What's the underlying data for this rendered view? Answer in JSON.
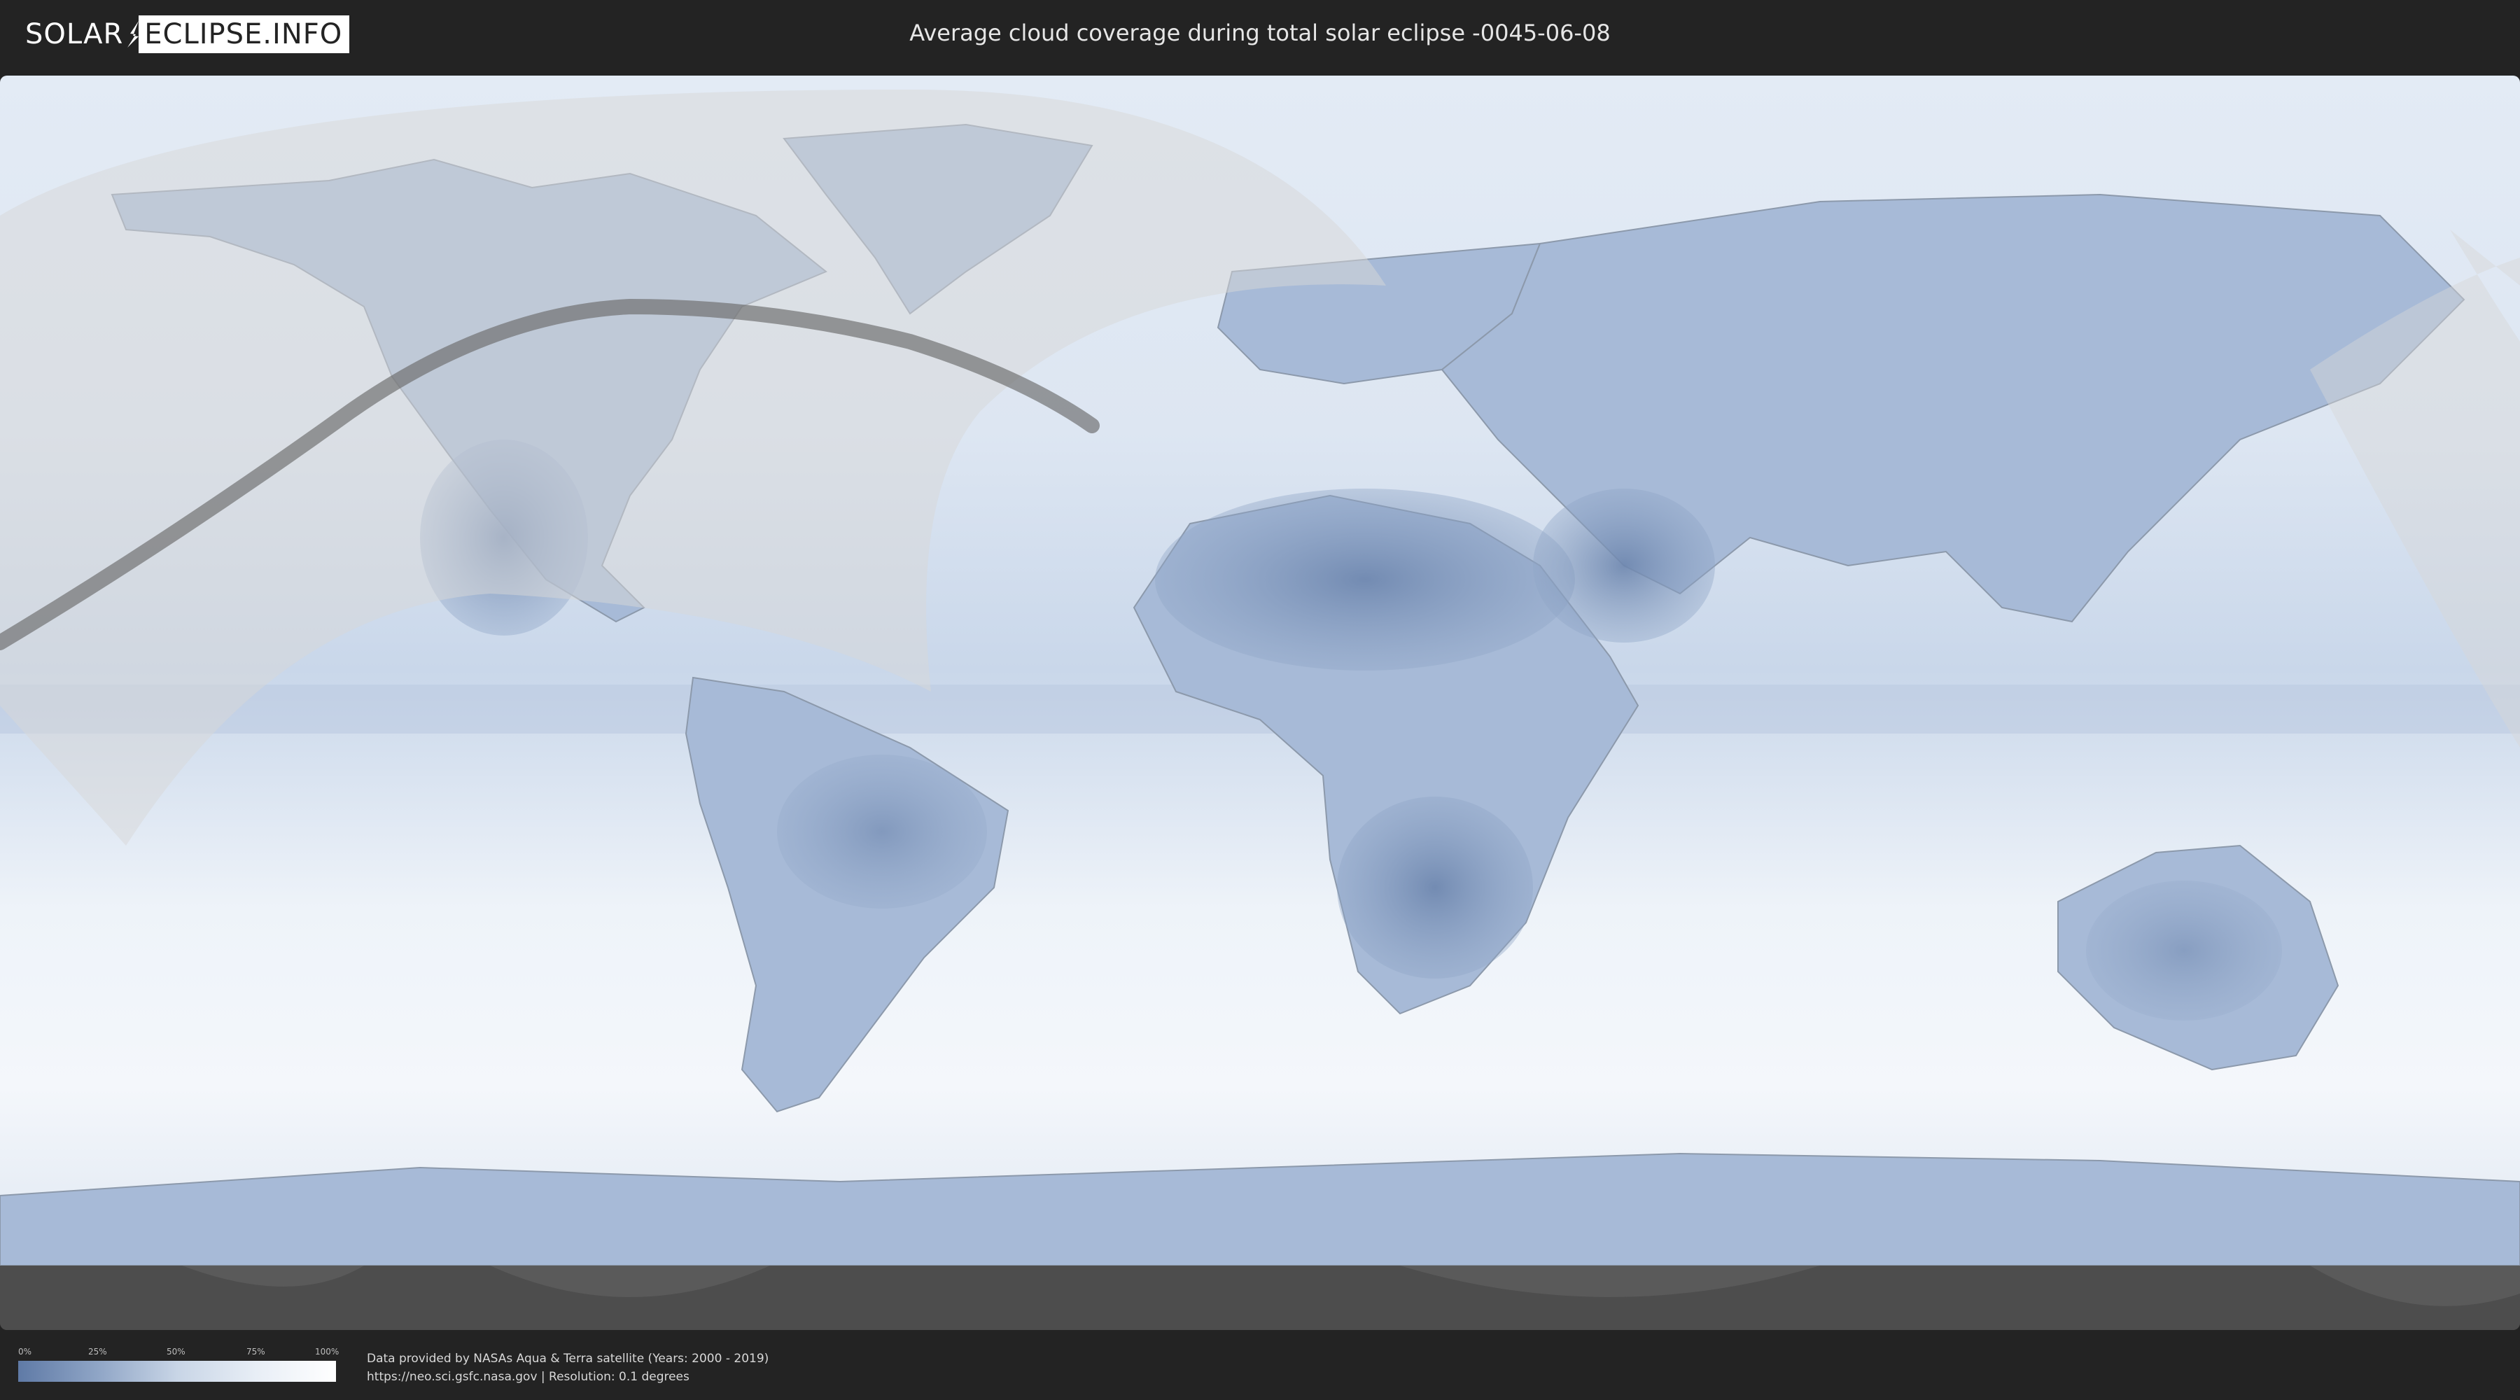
{
  "header": {
    "logo_left": "SOLAR",
    "logo_right": "ECLIPSE.INFO",
    "title": "Average cloud coverage during total solar eclipse -0045-06-08"
  },
  "legend": {
    "ticks": [
      "0%",
      "25%",
      "50%",
      "75%",
      "100%"
    ],
    "gradient_colors": [
      "#5f7aa6",
      "#8fa5c6",
      "#c8d5e6",
      "#e8eef6",
      "#ffffff"
    ]
  },
  "credits": {
    "line1": "Data provided by NASAs Aqua & Terra satellite (Years: 2000 - 2019)",
    "line2": "https://neo.sci.gsfc.nasa.gov | Resolution: 0.1 degrees"
  },
  "map": {
    "ocean_color": "#eef3f9",
    "cloud_low_color": "#6d86ae",
    "night_shade_color": "#dcdcdc",
    "eclipse_path_color": "#6a6a6a",
    "antarctic_band_color": "#4d4d4d"
  }
}
